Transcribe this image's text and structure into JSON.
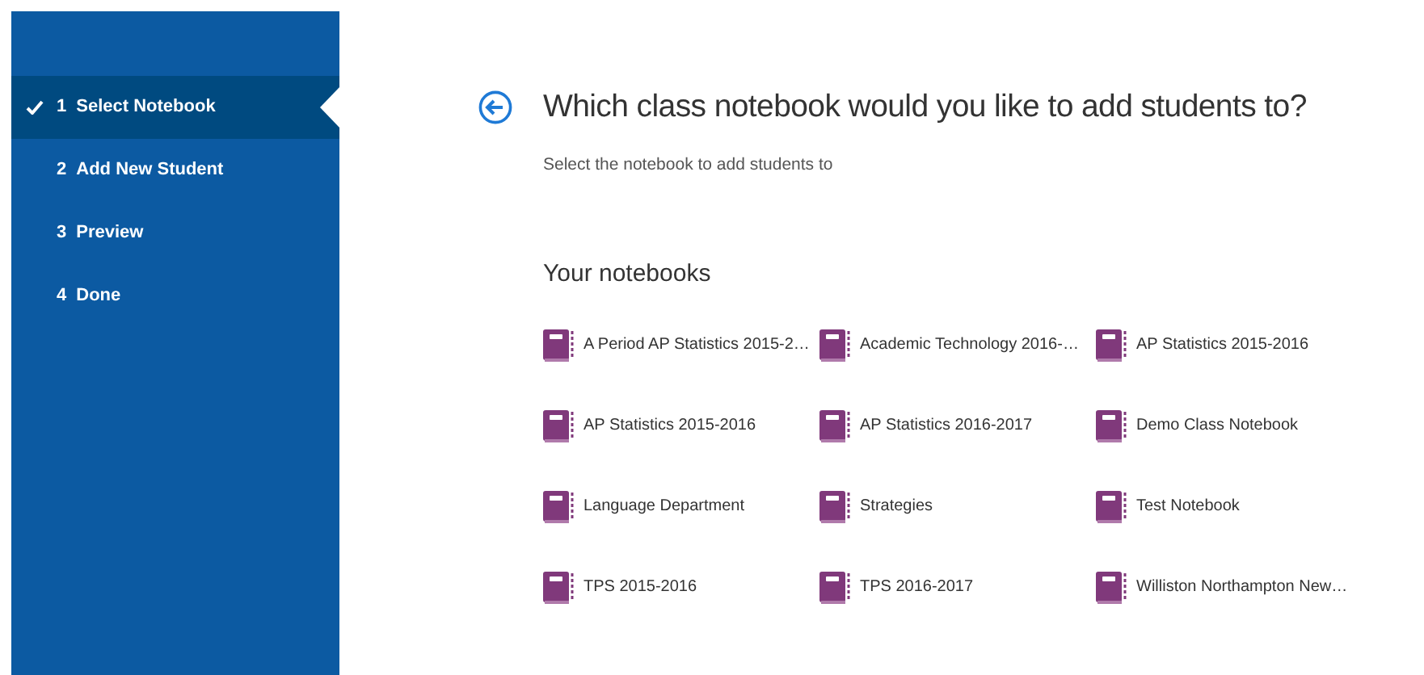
{
  "steps": [
    {
      "number": "1",
      "label": "Select Notebook",
      "selected": true
    },
    {
      "number": "2",
      "label": "Add New Student",
      "selected": false
    },
    {
      "number": "3",
      "label": "Preview",
      "selected": false
    },
    {
      "number": "4",
      "label": "Done",
      "selected": false
    }
  ],
  "title": "Which class notebook would you like to add students to?",
  "subtitle": "Select the notebook to add students to",
  "section_title": "Your notebooks",
  "notebooks": [
    {
      "name": "A Period AP Statistics 2015-2…"
    },
    {
      "name": "Academic Technology 2016-…"
    },
    {
      "name": "AP Statistics 2015-2016"
    },
    {
      "name": "AP Statistics 2015-2016"
    },
    {
      "name": "AP Statistics 2016-2017"
    },
    {
      "name": "Demo Class Notebook"
    },
    {
      "name": "Language Department"
    },
    {
      "name": "Strategies"
    },
    {
      "name": "Test Notebook"
    },
    {
      "name": "TPS 2015-2016"
    },
    {
      "name": "TPS 2016-2017"
    },
    {
      "name": "Williston Northampton New…"
    }
  ]
}
